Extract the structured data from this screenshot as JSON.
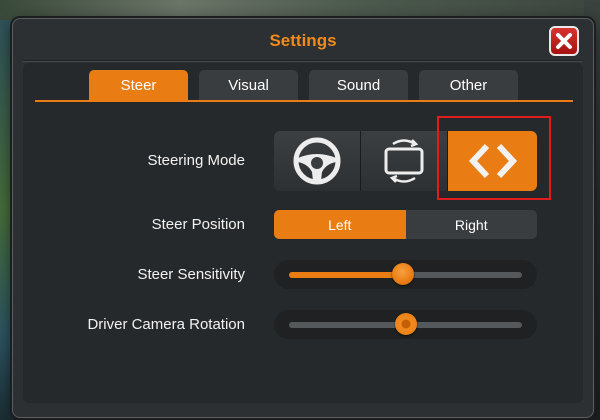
{
  "dialog": {
    "title": "Settings",
    "close_label": "close"
  },
  "tabs": [
    {
      "label": "Steer",
      "active": true
    },
    {
      "label": "Visual",
      "active": false
    },
    {
      "label": "Sound",
      "active": false
    },
    {
      "label": "Other",
      "active": false
    }
  ],
  "steering_mode": {
    "label": "Steering Mode",
    "options": [
      {
        "icon": "steering-wheel-icon",
        "active": false
      },
      {
        "icon": "tilt-rotate-icon",
        "active": false
      },
      {
        "icon": "left-right-arrows-icon",
        "active": true
      }
    ]
  },
  "steer_position": {
    "label": "Steer Position",
    "options": [
      "Left",
      "Right"
    ],
    "selected": "Left"
  },
  "steer_sensitivity": {
    "label": "Steer Sensitivity",
    "value_fraction": 0.49
  },
  "driver_camera_rotation": {
    "label": "Driver Camera Rotation",
    "value_fraction": 0.5
  },
  "colors": {
    "accent": "#e97c12",
    "title": "#f08a1c",
    "close": "#c4221f",
    "highlight_box": "#e11c1c"
  }
}
